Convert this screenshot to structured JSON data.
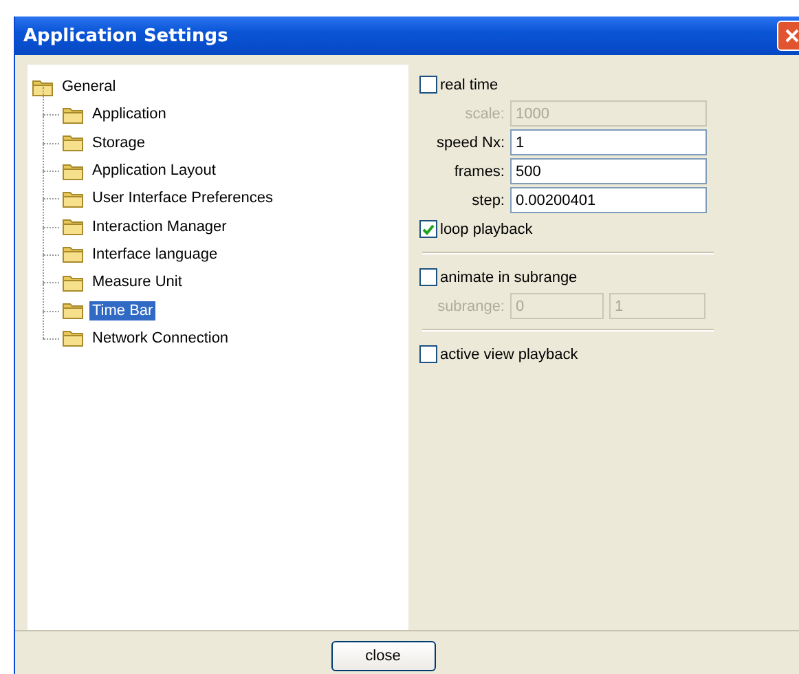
{
  "window": {
    "title": "Application Settings"
  },
  "tree": {
    "label": "General",
    "selected": false,
    "children": [
      {
        "label": "Application",
        "selected": false
      },
      {
        "label": "Storage",
        "selected": false
      },
      {
        "label": "Application Layout",
        "selected": false
      },
      {
        "label": "User Interface Preferences",
        "selected": false
      },
      {
        "label": "Interaction Manager",
        "selected": false
      },
      {
        "label": "Interface language",
        "selected": false
      },
      {
        "label": "Measure Unit",
        "selected": false
      },
      {
        "label": "Time Bar",
        "selected": true
      },
      {
        "label": "Network Connection",
        "selected": false
      }
    ]
  },
  "settings": [
    {
      "kind": "checkbox",
      "label": "real time",
      "checked": false
    },
    {
      "kind": "field",
      "label": "scale:",
      "value": "1000",
      "disabled": true
    },
    {
      "kind": "field",
      "label": "speed Nx:",
      "value": "1",
      "disabled": false
    },
    {
      "kind": "field",
      "label": "frames:",
      "value": "500",
      "disabled": false
    },
    {
      "kind": "field",
      "label": "step:",
      "value": "0.00200401",
      "disabled": false
    },
    {
      "kind": "checkbox",
      "label": "loop playback",
      "checked": true
    },
    {
      "kind": "separator"
    },
    {
      "kind": "checkbox",
      "label": "animate in subrange",
      "checked": false
    },
    {
      "kind": "range",
      "label": "subrange:",
      "from": "0",
      "to": "1",
      "disabled": true
    },
    {
      "kind": "separator"
    },
    {
      "kind": "checkbox",
      "label": "active view playback",
      "checked": false
    }
  ],
  "buttons": [
    {
      "label": "close"
    }
  ]
}
